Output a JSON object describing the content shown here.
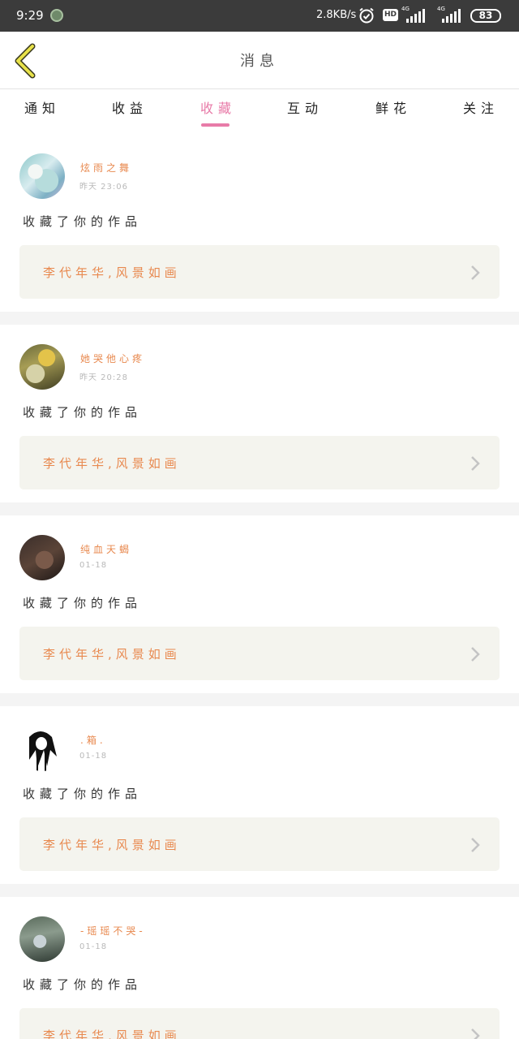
{
  "status_bar": {
    "time": "9:29",
    "net_speed": "2.8KB/s",
    "hd_label": "HD",
    "signal1_label": "4G",
    "signal2_label": "4G",
    "battery": "83"
  },
  "header": {
    "title": "消息",
    "back_icon": "chevron-left-icon",
    "accent_color": "#e8e24a"
  },
  "tabs": [
    {
      "label": "通知"
    },
    {
      "label": "收益"
    },
    {
      "label": "收藏",
      "active": true
    },
    {
      "label": "互动"
    },
    {
      "label": "鲜花"
    },
    {
      "label": "关注"
    }
  ],
  "messages": [
    {
      "username": "炫雨之舞",
      "time": "昨天 23:06",
      "action": "收藏了你的作品",
      "work_title": "李代年华,风景如画"
    },
    {
      "username": "她哭他心疼",
      "time": "昨天 20:28",
      "action": "收藏了你的作品",
      "work_title": "李代年华,风景如画"
    },
    {
      "username": "纯血天蝎",
      "time": "01-18",
      "action": "收藏了你的作品",
      "work_title": "李代年华,风景如画"
    },
    {
      "username": ".箱.",
      "time": "01-18",
      "action": "收藏了你的作品",
      "work_title": "李代年华,风景如画"
    },
    {
      "username": "-瑶瑶不哭-",
      "time": "01-18",
      "action": "收藏了你的作品",
      "work_title": "李代年华,风景如画"
    }
  ],
  "colors": {
    "accent_pink": "#e87ba8",
    "accent_orange": "#e8894f",
    "link_bg": "#f4f4ee"
  }
}
